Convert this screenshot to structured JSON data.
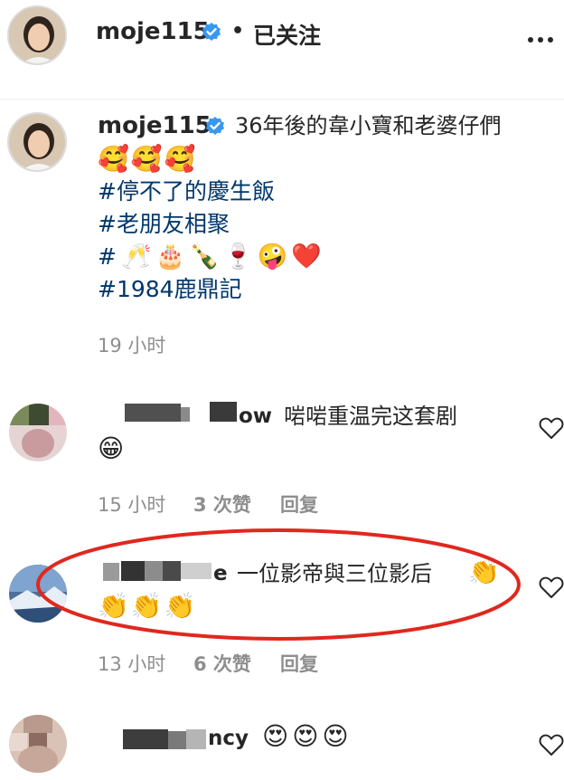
{
  "header": {
    "username": "moje115",
    "separator": "•",
    "follow_status": "已关注",
    "more_icon": "ellipsis-icon"
  },
  "caption": {
    "username": "moje115",
    "text": "36年後的韋小寶和老婆仔們",
    "line2_emojis": "🥰🥰🥰",
    "tag1": "#停不了的慶生飯",
    "tag2": "#老朋友相聚",
    "tag3_prefix": "#",
    "tag3_emojis": "🥂🎂🍾🍷🤪❤️",
    "tag4": "#1984鹿鼎記",
    "time": "19 小时"
  },
  "comments": [
    {
      "username_visible": "ow",
      "text": "啱啱重温完这套剧",
      "emoji_line": "😁",
      "time": "15 小时",
      "likes": "3 次赞",
      "reply": "回复"
    },
    {
      "username_visible": "e",
      "text": "一位影帝與三位影后",
      "trailing_emoji": "👏",
      "emoji_line": "👏👏👏",
      "time": "13 小时",
      "likes": "6 次赞",
      "reply": "回复"
    },
    {
      "username_visible": "ncy",
      "text": "😍😍😍"
    }
  ],
  "colors": {
    "hashtag": "#00376b",
    "meta": "#8e8e8e",
    "verified": "#3897f0",
    "annotation_circle": "#e0281e"
  }
}
